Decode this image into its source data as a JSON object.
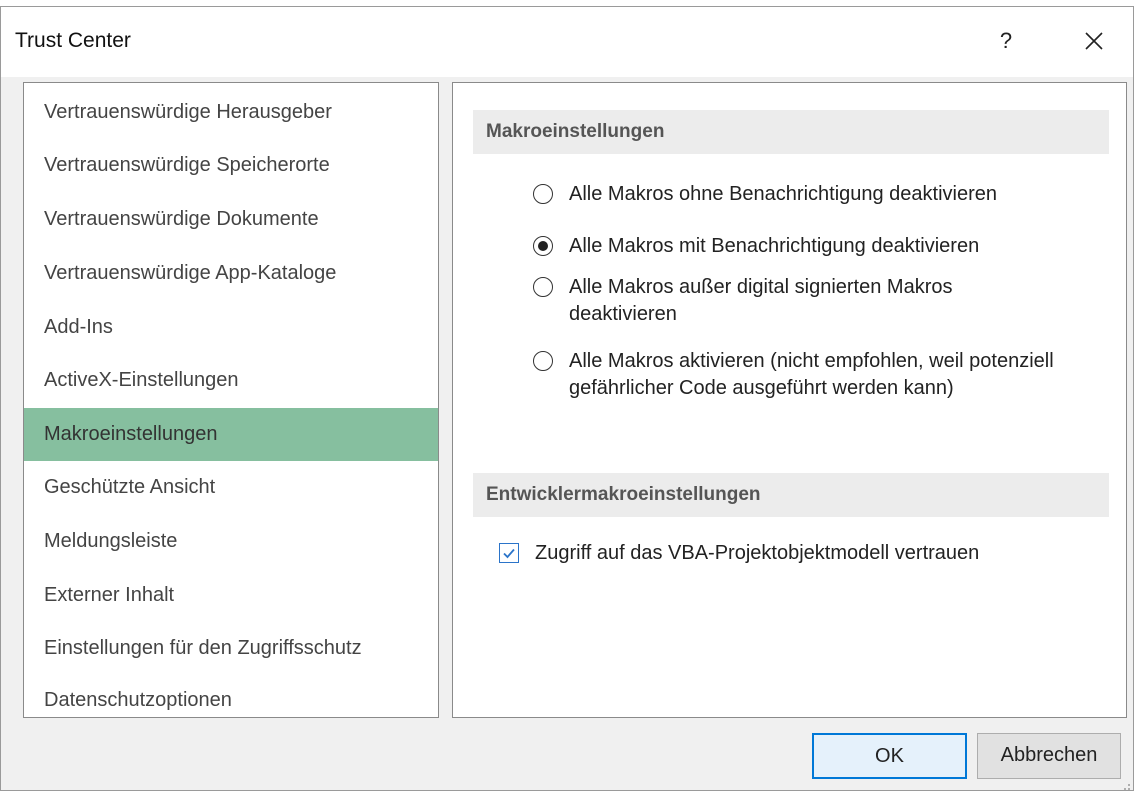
{
  "dialog": {
    "title": "Trust Center",
    "help_label": "?",
    "close_icon": "close-icon"
  },
  "sidebar": {
    "items": [
      {
        "label": "Vertrauenswürdige Herausgeber",
        "selected": false
      },
      {
        "label": "Vertrauenswürdige Speicherorte",
        "selected": false
      },
      {
        "label": "Vertrauenswürdige Dokumente",
        "selected": false
      },
      {
        "label": "Vertrauenswürdige App-Kataloge",
        "selected": false
      },
      {
        "label": "Add-Ins",
        "selected": false
      },
      {
        "label": "ActiveX-Einstellungen",
        "selected": false
      },
      {
        "label": "Makroeinstellungen",
        "selected": true
      },
      {
        "label": "Geschützte Ansicht",
        "selected": false
      },
      {
        "label": "Meldungsleiste",
        "selected": false
      },
      {
        "label": "Externer Inhalt",
        "selected": false
      },
      {
        "label": "Einstellungen für den Zugriffsschutz",
        "selected": false
      },
      {
        "label": "Datenschutzoptionen",
        "selected": false
      }
    ],
    "selected_color": "#86bf9f"
  },
  "main": {
    "macro_header": "Makroeinstellungen",
    "options": [
      {
        "label": "Alle Makros ohne Benachrichtigung deaktivieren",
        "checked": false
      },
      {
        "label": "Alle Makros mit Benachrichtigung deaktivieren",
        "checked": true
      },
      {
        "label": "Alle Makros außer digital signierten Makros deaktivieren",
        "checked": false
      },
      {
        "label": "Alle Makros aktivieren (nicht empfohlen, weil potenziell gefährlicher Code ausgeführt werden kann)",
        "checked": false
      }
    ],
    "developer_header": "Entwicklermakroeinstellungen",
    "vba_checkbox": {
      "label": "Zugriff auf das VBA-Projektobjektmodell vertrauen",
      "checked": true
    }
  },
  "buttons": {
    "ok_label": "OK",
    "cancel_label": "Abbrechen"
  }
}
